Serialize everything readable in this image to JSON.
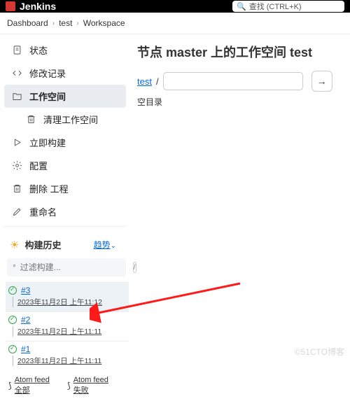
{
  "topbar": {
    "brand": "Jenkins",
    "search_icon": "🔍",
    "search_placeholder": "查找 (CTRL+K)"
  },
  "breadcrumb": {
    "items": [
      "Dashboard",
      "test",
      "Workspace"
    ]
  },
  "sidebar": {
    "items": [
      {
        "label": "状态"
      },
      {
        "label": "修改记录"
      },
      {
        "label": "工作空间"
      },
      {
        "label": "清理工作空间"
      },
      {
        "label": "立即构建"
      },
      {
        "label": "配置"
      },
      {
        "label": "删除 工程"
      },
      {
        "label": "重命名"
      }
    ]
  },
  "history": {
    "heading": "构建历史",
    "trend": "趋势",
    "filter_placeholder": "过滤构建...",
    "filter_hint": "/",
    "builds": [
      {
        "id": "#3",
        "timestamp": "2023年11月2日 上午11:12"
      },
      {
        "id": "#2",
        "timestamp": "2023年11月2日 上午11:11"
      },
      {
        "id": "#1",
        "timestamp": "2023年11月2日 上午11:11"
      }
    ],
    "feeds": {
      "all": "Atom feed 全部",
      "fail": "Atom feed 失败"
    }
  },
  "main": {
    "title": "节点 master 上的工作空间 test",
    "project_link": "test",
    "slash": "/",
    "path_input": "",
    "go_arrow": "→",
    "empty_dir": "空目录"
  },
  "watermark": "©51CTO博客"
}
